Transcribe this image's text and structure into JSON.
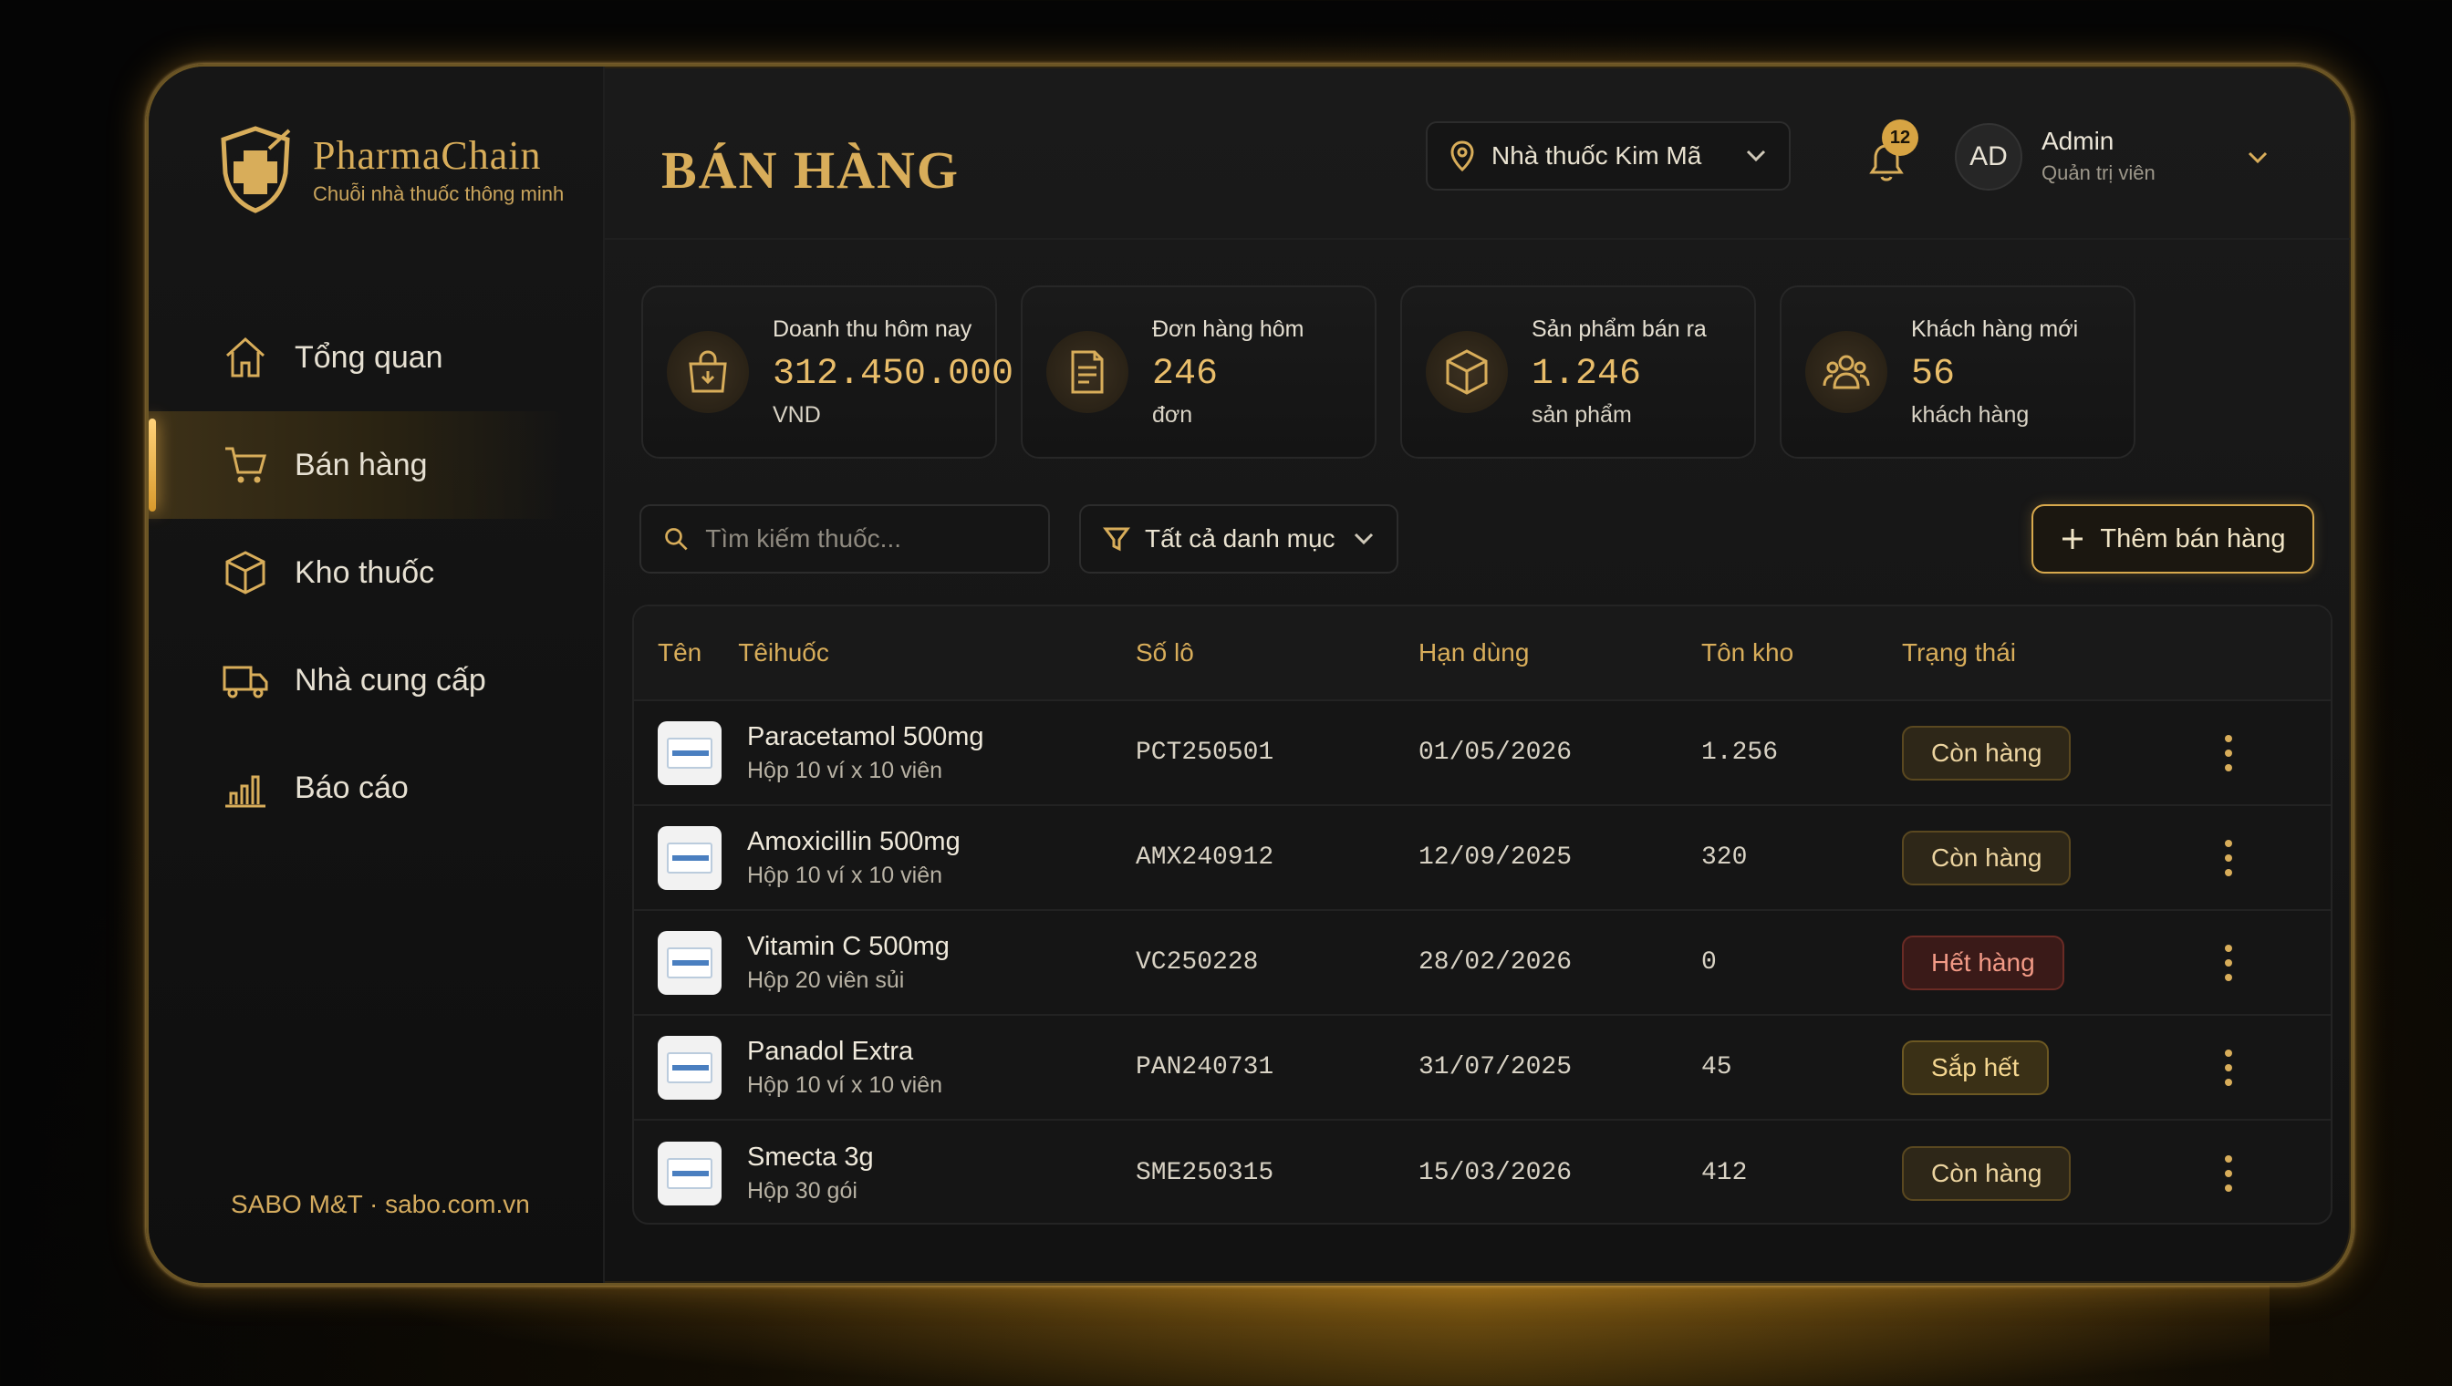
{
  "brand": {
    "name": "PharmaChain",
    "tagline": "Chuỗi nhà thuốc thông minh"
  },
  "sidebar": {
    "items": [
      {
        "label": "Tổng quan",
        "icon": "home-icon"
      },
      {
        "label": "Bán hàng",
        "icon": "cart-icon",
        "active": true
      },
      {
        "label": "Kho thuốc",
        "icon": "box-icon"
      },
      {
        "label": "Nhà cung cấp",
        "icon": "truck-icon"
      },
      {
        "label": "Báo cáo",
        "icon": "chart-icon"
      }
    ],
    "footer": "SABO M&T · sabo.com.vn"
  },
  "header": {
    "title": "BÁN HÀNG",
    "store": "Nhà thuốc Kim Mã",
    "notifications": "12",
    "user": {
      "initials": "AD",
      "name": "Admin",
      "role": "Quản trị viên"
    }
  },
  "stats": [
    {
      "label": "Doanh thu hôm nay",
      "value": "312.450.000",
      "unit": "VND",
      "icon": "shopping-bag-icon"
    },
    {
      "label": "Đơn hàng hôm",
      "value": "246",
      "unit": "đơn",
      "icon": "receipt-icon"
    },
    {
      "label": "Sản phẩm bán ra",
      "value": "1.246",
      "unit": "sản phẩm",
      "icon": "box-icon"
    },
    {
      "label": "Khách hàng mới",
      "value": "56",
      "unit": "khách hàng",
      "icon": "users-icon"
    }
  ],
  "toolbar": {
    "search_placeholder": "Tìm kiếm thuốc...",
    "filter_label": "Tất cả danh mục",
    "add_label": "Thêm bán hàng"
  },
  "table": {
    "headers": {
      "img": "Tên",
      "name": "Têihuốc",
      "batch": "Số lô",
      "expiry": "Hạn dùng",
      "stock": "Tôn kho",
      "status": "Trạng thái"
    },
    "rows": [
      {
        "name": "Paracetamol 500mg",
        "pack": "Hộp 10 ví x 10 viên",
        "batch": "PCT250501",
        "expiry": "01/05/2026",
        "stock": "1.256",
        "status": "Còn hàng",
        "kind": "in"
      },
      {
        "name": "Amoxicillin 500mg",
        "pack": "Hộp 10 ví x 10 viên",
        "batch": "AMX240912",
        "expiry": "12/09/2025",
        "stock": "320",
        "status": "Còn hàng",
        "kind": "in"
      },
      {
        "name": "Vitamin C 500mg",
        "pack": "Hộp 20 viên sủi",
        "batch": "VC250228",
        "expiry": "28/02/2026",
        "stock": "0",
        "status": "Hết hàng",
        "kind": "out"
      },
      {
        "name": "Panadol Extra",
        "pack": "Hộp 10 ví x 10 viên",
        "batch": "PAN240731",
        "expiry": "31/07/2025",
        "stock": "45",
        "status": "Sắp hết",
        "kind": "low"
      },
      {
        "name": "Smecta 3g",
        "pack": "Hộp 30 gói",
        "batch": "SME250315",
        "expiry": "15/03/2026",
        "stock": "412",
        "status": "Còn hàng",
        "kind": "in"
      }
    ]
  },
  "colors": {
    "accent": "#d8ad5a",
    "background": "#121212",
    "out_of_stock": "#f29a86"
  }
}
